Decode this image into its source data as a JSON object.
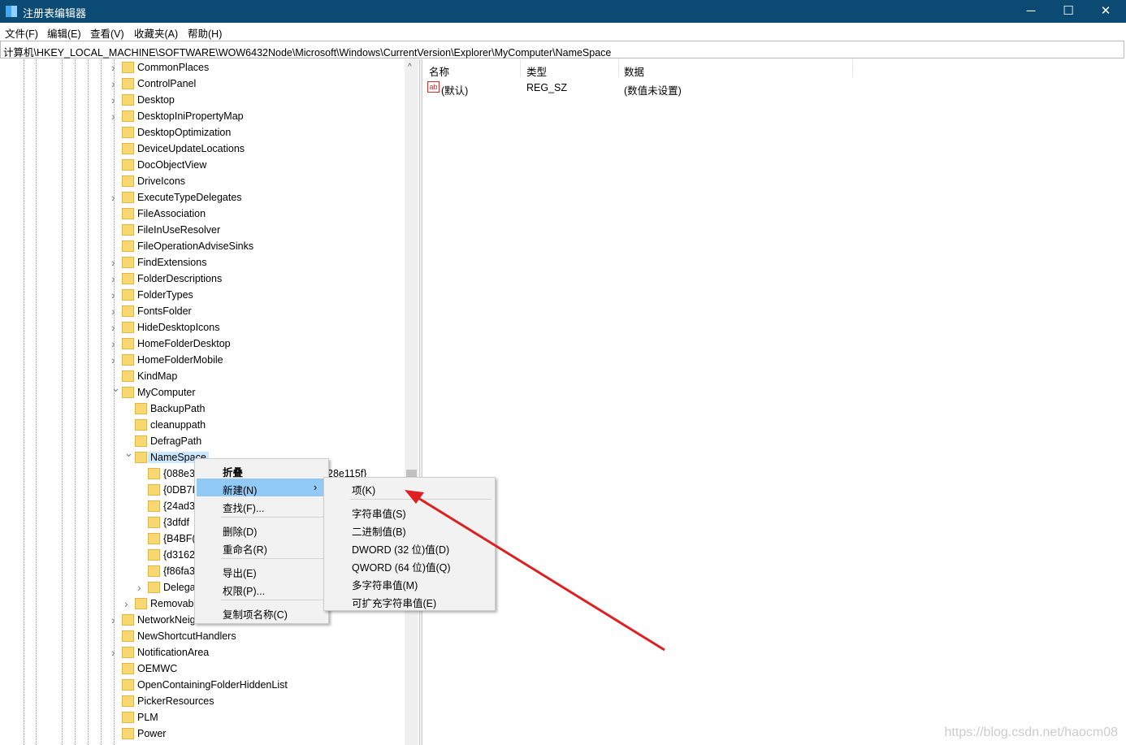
{
  "window": {
    "title": "注册表编辑器",
    "minimize": "─",
    "maximize": "☐",
    "close": "✕"
  },
  "menubar": [
    "文件(F)",
    "编辑(E)",
    "查看(V)",
    "收藏夹(A)",
    "帮助(H)"
  ],
  "address": "计算机\\HKEY_LOCAL_MACHINE\\SOFTWARE\\WOW6432Node\\Microsoft\\Windows\\CurrentVersion\\Explorer\\MyComputer\\NameSpace",
  "tree": [
    {
      "label": "CommonPlaces",
      "level": 0,
      "exp": ">"
    },
    {
      "label": "ControlPanel",
      "level": 0,
      "exp": ">"
    },
    {
      "label": "Desktop",
      "level": 0,
      "exp": ">"
    },
    {
      "label": "DesktopIniPropertyMap",
      "level": 0,
      "exp": ">"
    },
    {
      "label": "DesktopOptimization",
      "level": 0,
      "exp": ""
    },
    {
      "label": "DeviceUpdateLocations",
      "level": 0,
      "exp": ""
    },
    {
      "label": "DocObjectView",
      "level": 0,
      "exp": ""
    },
    {
      "label": "DriveIcons",
      "level": 0,
      "exp": ""
    },
    {
      "label": "ExecuteTypeDelegates",
      "level": 0,
      "exp": ">"
    },
    {
      "label": "FileAssociation",
      "level": 0,
      "exp": ""
    },
    {
      "label": "FileInUseResolver",
      "level": 0,
      "exp": ""
    },
    {
      "label": "FileOperationAdviseSinks",
      "level": 0,
      "exp": ""
    },
    {
      "label": "FindExtensions",
      "level": 0,
      "exp": ">"
    },
    {
      "label": "FolderDescriptions",
      "level": 0,
      "exp": ">"
    },
    {
      "label": "FolderTypes",
      "level": 0,
      "exp": ">"
    },
    {
      "label": "FontsFolder",
      "level": 0,
      "exp": ">"
    },
    {
      "label": "HideDesktopIcons",
      "level": 0,
      "exp": ">"
    },
    {
      "label": "HomeFolderDesktop",
      "level": 0,
      "exp": ">"
    },
    {
      "label": "HomeFolderMobile",
      "level": 0,
      "exp": ">"
    },
    {
      "label": "KindMap",
      "level": 0,
      "exp": ""
    },
    {
      "label": "MyComputer",
      "level": 0,
      "exp": "v"
    },
    {
      "label": "BackupPath",
      "level": 1,
      "exp": ""
    },
    {
      "label": "cleanuppath",
      "level": 1,
      "exp": ""
    },
    {
      "label": "DefragPath",
      "level": 1,
      "exp": ""
    },
    {
      "label": "NameSpace",
      "level": 1,
      "exp": "v",
      "selected": true
    },
    {
      "label": "{088e3",
      "level": 2,
      "exp": ""
    },
    {
      "label": "{0DB7I",
      "level": 2,
      "exp": ""
    },
    {
      "label": "{24ad3",
      "level": 2,
      "exp": ""
    },
    {
      "label": "{3dfdf",
      "level": 2,
      "exp": ""
    },
    {
      "label": "{B4BF(",
      "level": 2,
      "exp": ""
    },
    {
      "label": "{d3162",
      "level": 2,
      "exp": ""
    },
    {
      "label": "{f86fa3",
      "level": 2,
      "exp": ""
    },
    {
      "label": "Delega",
      "level": 2,
      "exp": ">"
    },
    {
      "label": "Removab",
      "level": 1,
      "exp": ">"
    },
    {
      "label": "NetworkNeighborhood",
      "level": 0,
      "exp": ">"
    },
    {
      "label": "NewShortcutHandlers",
      "level": 0,
      "exp": ""
    },
    {
      "label": "NotificationArea",
      "level": 0,
      "exp": ">"
    },
    {
      "label": "OEMWC",
      "level": 0,
      "exp": ""
    },
    {
      "label": "OpenContainingFolderHiddenList",
      "level": 0,
      "exp": ""
    },
    {
      "label": "PickerResources",
      "level": 0,
      "exp": ""
    },
    {
      "label": "PLM",
      "level": 0,
      "exp": ""
    },
    {
      "label": "Power",
      "level": 0,
      "exp": ""
    }
  ],
  "tree_partial_tail": "28e115f}",
  "values": {
    "headers": [
      "名称",
      "类型",
      "数据"
    ],
    "rows": [
      {
        "name": "(默认)",
        "type": "REG_SZ",
        "data": "(数值未设置)",
        "icon": "ab"
      }
    ]
  },
  "context_menu": {
    "items": [
      "折叠",
      "新建(N)",
      "查找(F)...",
      "删除(D)",
      "重命名(R)",
      "导出(E)",
      "权限(P)...",
      "复制项名称(C)"
    ]
  },
  "submenu": {
    "items": [
      "项(K)",
      "字符串值(S)",
      "二进制值(B)",
      "DWORD (32 位)值(D)",
      "QWORD (64 位)值(Q)",
      "多字符串值(M)",
      "可扩充字符串值(E)"
    ]
  },
  "watermark": "https://blog.csdn.net/haocm08",
  "colors": {
    "titlebar": "#0b4a72",
    "highlight": "#91c9f7",
    "arrow": "#e02020"
  }
}
